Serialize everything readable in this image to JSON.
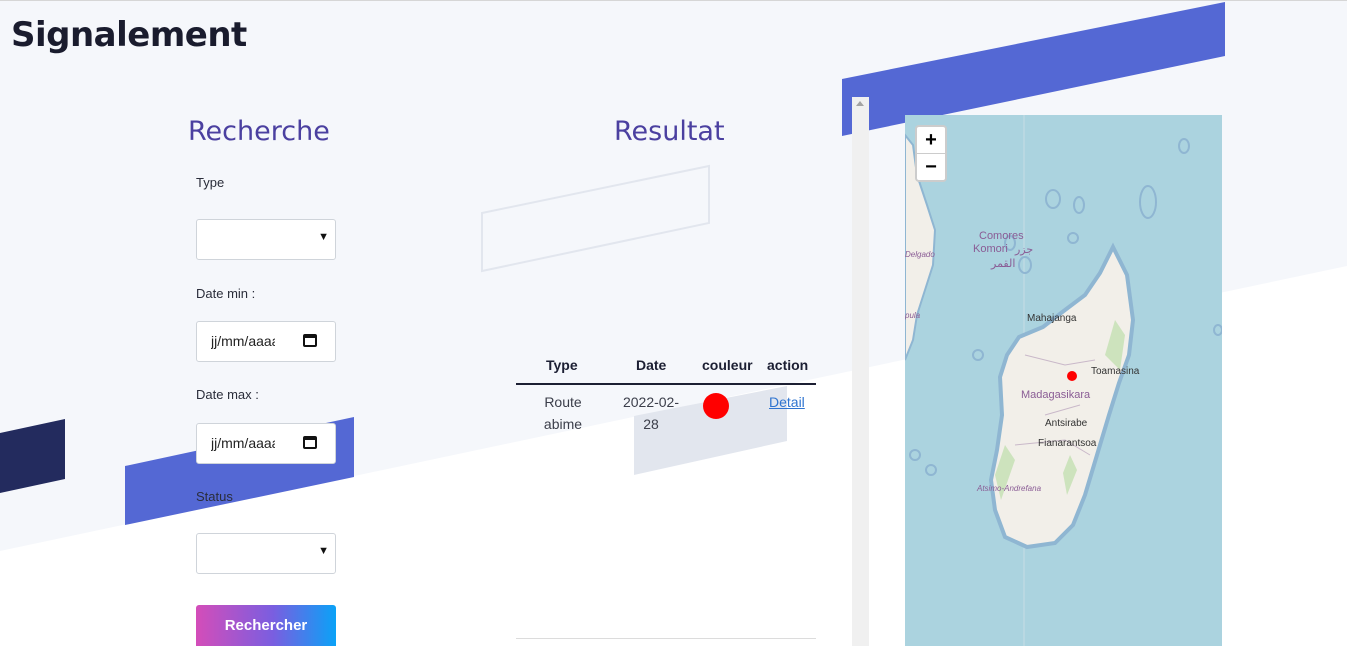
{
  "page": {
    "title": "Signalement"
  },
  "search": {
    "title": "Recherche",
    "type_label": "Type",
    "date_min_label": "Date min :",
    "date_max_label": "Date max :",
    "status_label": "Status",
    "date_placeholder": "jj/mm/aaaa",
    "submit_label": "Rechercher",
    "colors": {
      "button_start": "#d44db9",
      "button_end": "#0aa2f7"
    }
  },
  "results": {
    "title": "Resultat",
    "columns": [
      "Type",
      "Date",
      "couleur",
      "action"
    ],
    "rows": [
      {
        "type_line1": "Route",
        "type_line2": "abime",
        "date_line1": "2022-02-",
        "date_line2": "28",
        "color": "#ff0000",
        "action": "Detail"
      }
    ]
  },
  "map": {
    "zoom_in": "+",
    "zoom_out": "−",
    "labels": {
      "comores_1": "Comores",
      "comores_2": "Komori",
      "comores_3": "جزر",
      "comores_4": "القمر",
      "delgado": "Delgado",
      "pula": "pula",
      "mahajanga": "Mahajanga",
      "toamasina": "Toamasina",
      "madagascar": "Madagasikara",
      "antsirabe": "Antsirabe",
      "fianarantsoa": "Fianarantsoa",
      "atsimo": "Atsimo-Andrefana"
    },
    "colors": {
      "water": "#abd3df",
      "land": "#f2efe9",
      "marker": "#ff0000"
    }
  },
  "theme": {
    "accent": "#5468d4",
    "dark_accent": "#232b5e",
    "title_color": "#4b40a0"
  }
}
